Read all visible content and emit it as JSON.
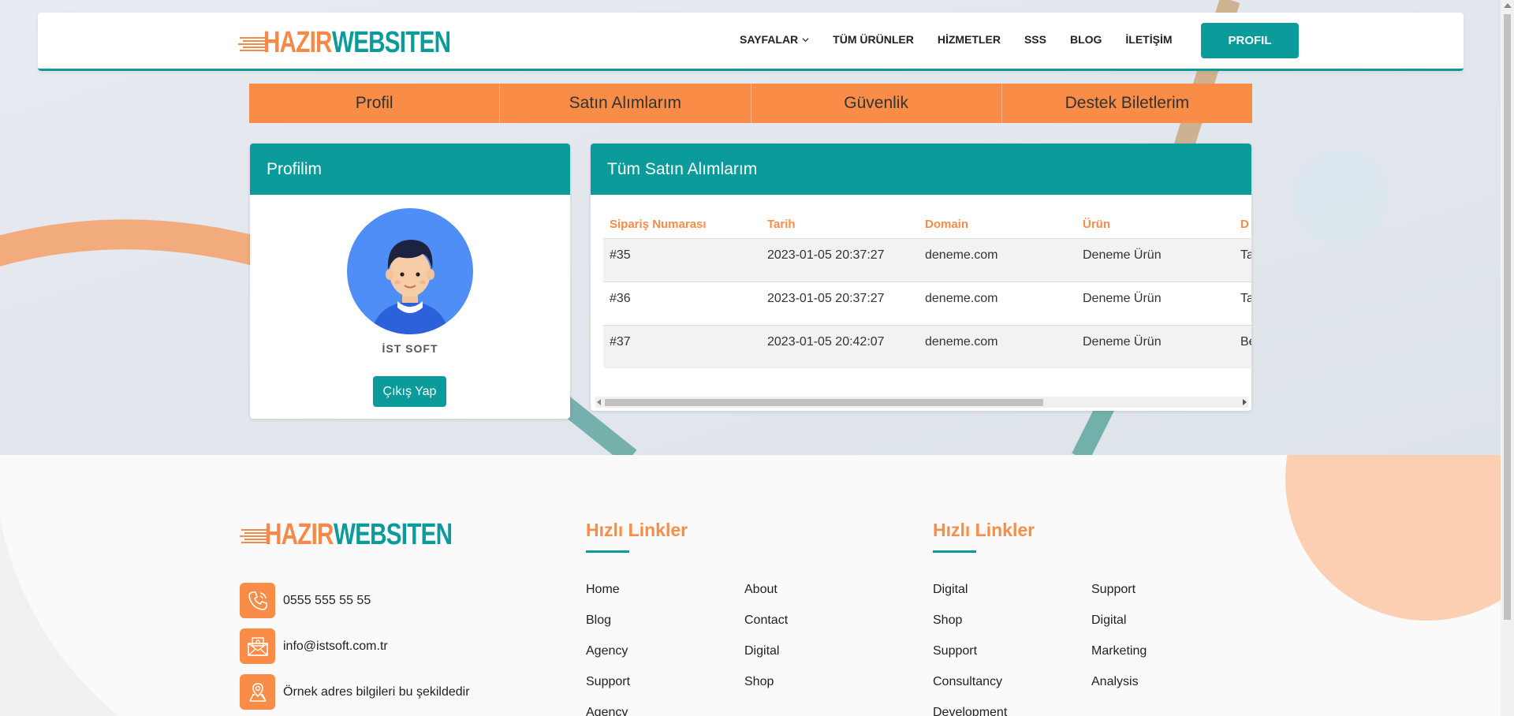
{
  "brand": {
    "part1": "HAZIR",
    "part2": "WEBSITEN"
  },
  "nav": {
    "items": [
      {
        "label": "SAYFALAR"
      },
      {
        "label": "TÜM ÜRÜNLER"
      },
      {
        "label": "HİZMETLER"
      },
      {
        "label": "SSS"
      },
      {
        "label": "BLOG"
      },
      {
        "label": "İLETİŞİM"
      }
    ],
    "profile_button": "PROFIL"
  },
  "tabs": [
    "Profil",
    "Satın Alımlarım",
    "Güvenlik",
    "Destek Biletlerim"
  ],
  "profile_card": {
    "title": "Profilim",
    "username": "İST SOFT",
    "logout": "Çıkış Yap"
  },
  "orders_card": {
    "title": "Tüm Satın Alımlarım",
    "columns": [
      "Sipariş Numarası",
      "Tarih",
      "Domain",
      "Ürün",
      "D"
    ],
    "rows": [
      [
        "#35",
        "2023-01-05 20:37:27",
        "deneme.com",
        "Deneme Ürün",
        "Ta"
      ],
      [
        "#36",
        "2023-01-05 20:37:27",
        "deneme.com",
        "Deneme Ürün",
        "Ta"
      ],
      [
        "#37",
        "2023-01-05 20:42:07",
        "deneme.com",
        "Deneme Ürün",
        "Be"
      ]
    ]
  },
  "footer": {
    "contacts": [
      {
        "icon": "phone-icon",
        "text": "0555 555 55 55"
      },
      {
        "icon": "mail-icon",
        "text": "info@istsoft.com.tr"
      },
      {
        "icon": "location-icon",
        "text": "Örnek adres bilgileri bu şekildedir"
      }
    ],
    "col1": {
      "title": "Hızlı Linkler",
      "left": [
        "Home",
        "Blog",
        "Agency",
        "Support",
        "Agency"
      ],
      "right": [
        "About",
        "Contact",
        "Digital",
        "Shop"
      ]
    },
    "col2": {
      "title": "Hızlı Linkler",
      "left": [
        "Digital",
        "Shop",
        "Support",
        "Consultancy",
        "Development"
      ],
      "right": [
        "Support",
        "Digital",
        "Marketing",
        "Analysis"
      ]
    }
  },
  "colors": {
    "teal": "#0b9b9b",
    "orange": "#f98c47"
  }
}
